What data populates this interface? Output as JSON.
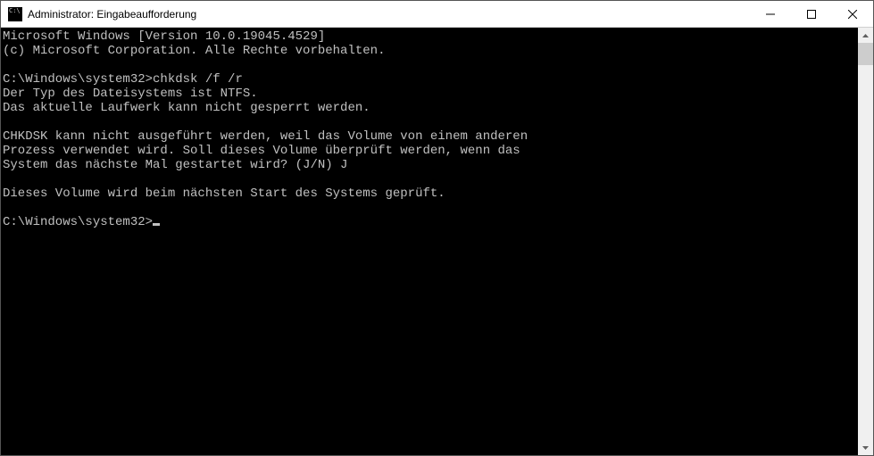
{
  "window": {
    "title": "Administrator: Eingabeaufforderung"
  },
  "terminal": {
    "lines": [
      "Microsoft Windows [Version 10.0.19045.4529]",
      "(c) Microsoft Corporation. Alle Rechte vorbehalten.",
      "",
      "C:\\Windows\\system32>chkdsk /f /r",
      "Der Typ des Dateisystems ist NTFS.",
      "Das aktuelle Laufwerk kann nicht gesperrt werden.",
      "",
      "CHKDSK kann nicht ausgeführt werden, weil das Volume von einem anderen",
      "Prozess verwendet wird. Soll dieses Volume überprüft werden, wenn das",
      "System das nächste Mal gestartet wird? (J/N) J",
      "",
      "Dieses Volume wird beim nächsten Start des Systems geprüft.",
      "",
      "C:\\Windows\\system32>"
    ]
  }
}
